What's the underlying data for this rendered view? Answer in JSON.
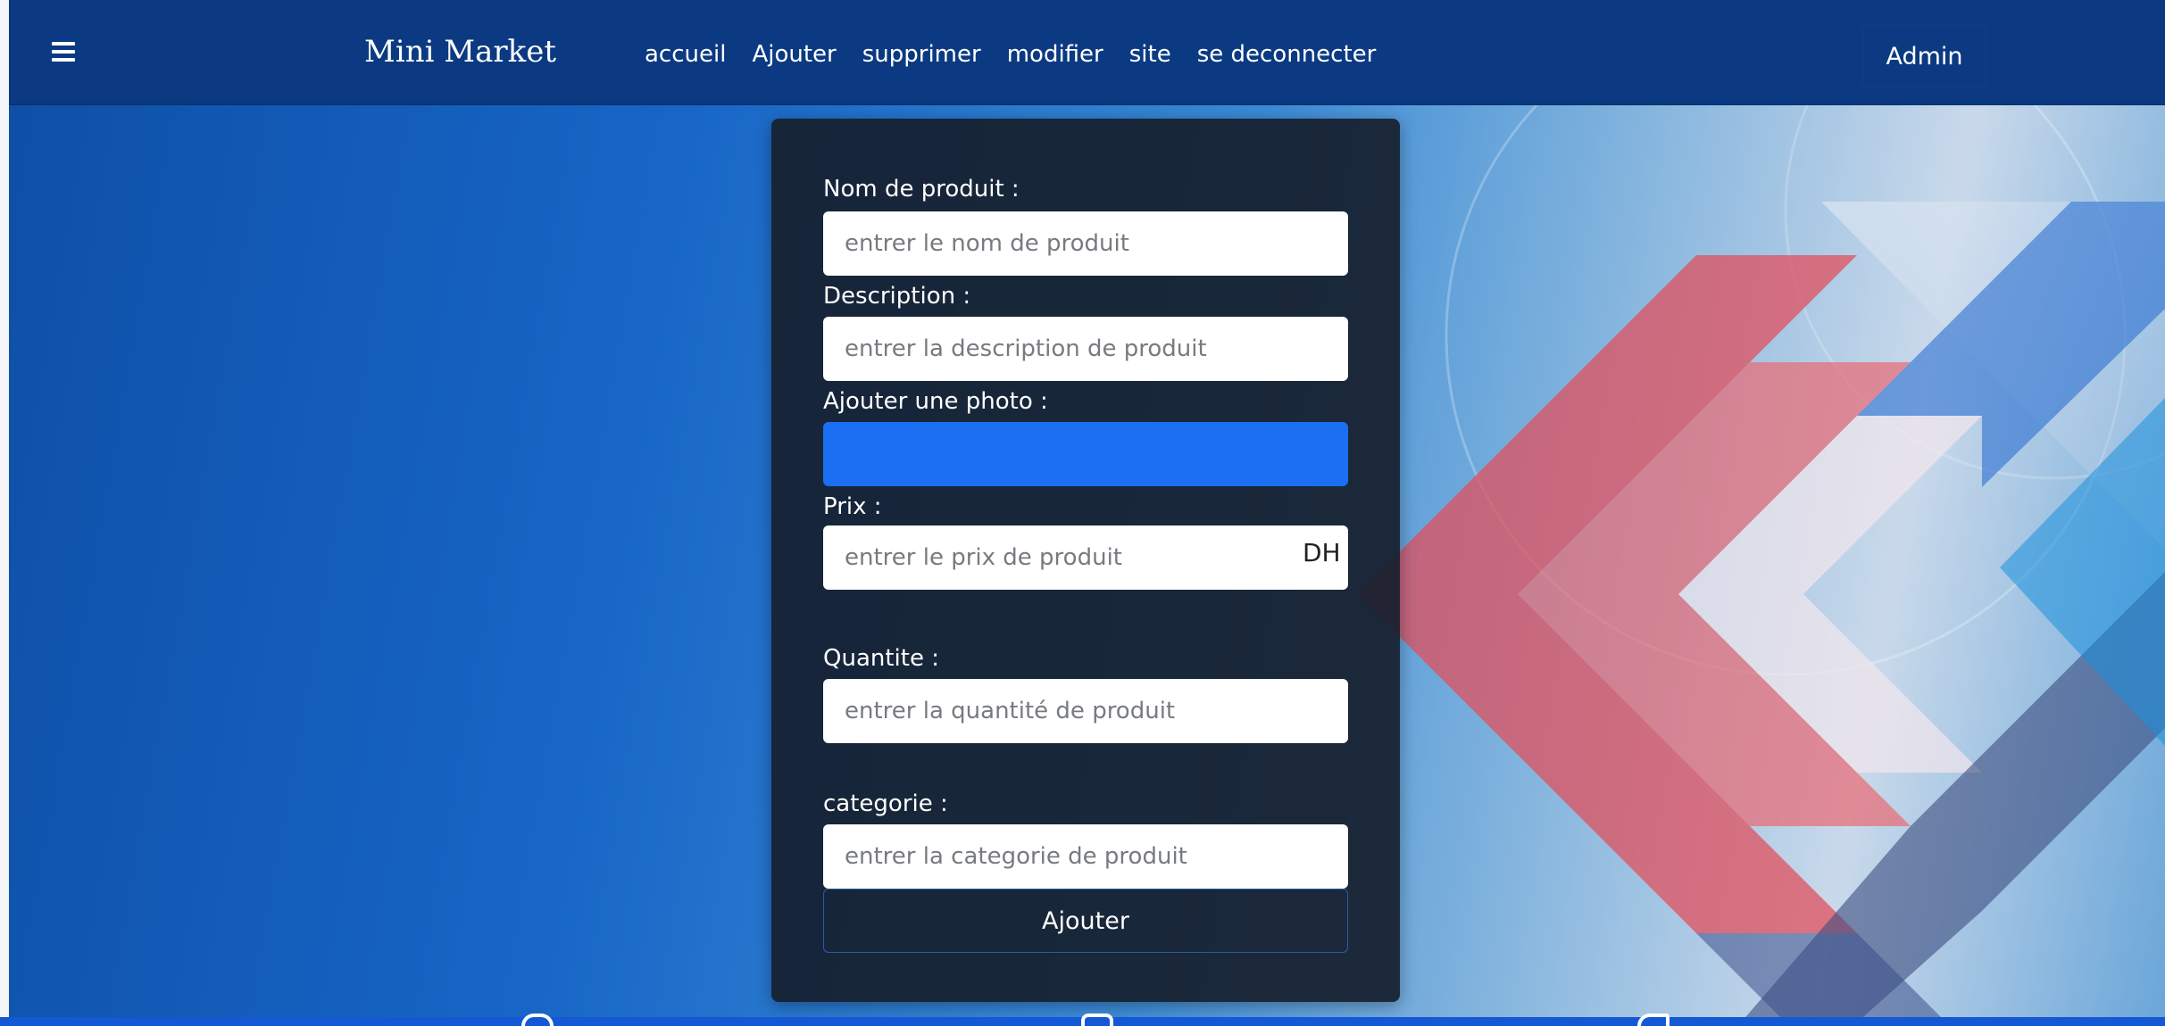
{
  "navbar": {
    "menu_icon": "hamburger-icon",
    "brand": "Mini Market",
    "links": [
      "accueil",
      "Ajouter",
      "supprimer",
      "modifier",
      "site",
      "se deconnecter"
    ],
    "admin_label": "Admin"
  },
  "form": {
    "name_label": "Nom de produit :",
    "name_placeholder": "entrer le nom de produit",
    "description_label": "Description :",
    "description_placeholder": "entrer la description de produit",
    "photo_label": "Ajouter une photo :",
    "price_label": "Prix :",
    "price_placeholder": "entrer le prix de produit",
    "price_suffix": "DH",
    "quantity_label": "Quantite :",
    "quantity_placeholder": "entrer la quantité de produit",
    "category_label": "categorie :",
    "category_placeholder": "entrer la categorie de produit",
    "submit_label": "Ajouter"
  },
  "footer": {
    "icons": [
      "facebook-icon",
      "instagram-icon",
      "twitter-icon"
    ]
  },
  "colors": {
    "navbar": "#0b3a82",
    "card": "#151f2d",
    "file_button": "#1a6ff2",
    "footer": "#1558d6"
  }
}
